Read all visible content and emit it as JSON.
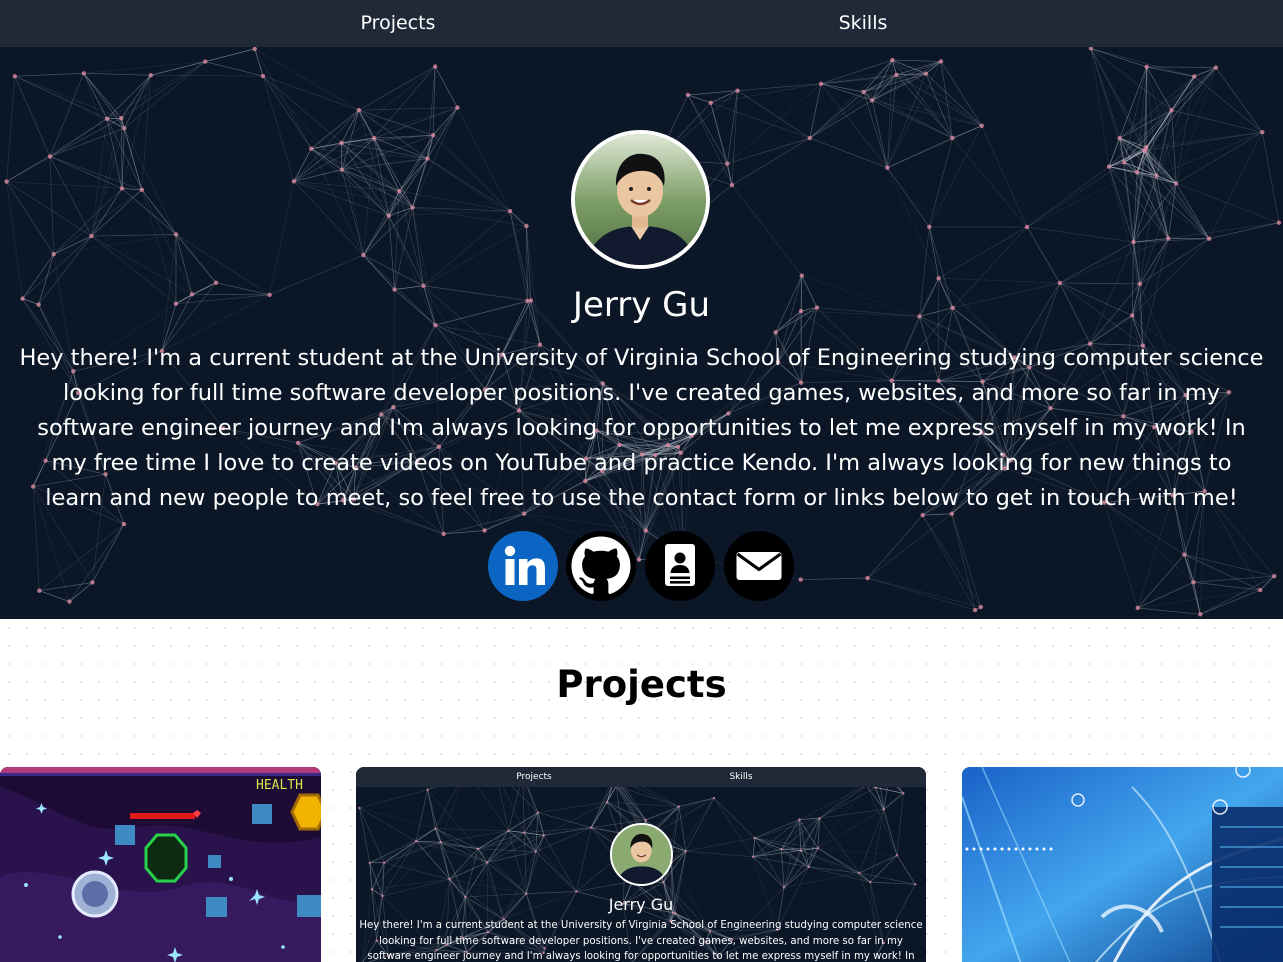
{
  "nav": {
    "items": [
      {
        "label": "Projects"
      },
      {
        "label": "Skills"
      }
    ]
  },
  "hero": {
    "name": "Jerry Gu",
    "bio_lines": [
      "Hey there! I'm a current student at the University of Virginia School of Engineering studying computer science",
      "looking for full time software developer positions. I've created games, websites, and more so far in my",
      "software engineer journey and I'm always looking for opportunities to let me express myself in my work! In",
      "my free time I love to create videos on YouTube and practice Kendo. I'm always looking for new things to",
      "learn and new people to meet, so feel free to use the contact form or links below to get in touch with me!"
    ],
    "socials": [
      {
        "icon": "linkedin-icon",
        "color": "#0a66c2"
      },
      {
        "icon": "github-icon",
        "color": "#000000"
      },
      {
        "icon": "resume-icon",
        "color": "#000000"
      },
      {
        "icon": "mail-icon",
        "color": "#000000"
      }
    ]
  },
  "projects": {
    "title": "Projects",
    "cards": [
      {
        "image": "pixel-space-game-screenshot",
        "hud_text": "HEALTH"
      },
      {
        "image": "portfolio-website-screenshot",
        "nav": [
          "Projects",
          "Skills"
        ],
        "name": "Jerry Gu",
        "bio_lines": [
          "Hey there! I'm a current student at the University of Virginia School of Engineering studying computer science",
          "looking for full time software developer positions. I've created games, websites, and more so far in my",
          "software engineer journey and I'm always looking for opportunities to let me express myself in my work! In"
        ]
      },
      {
        "image": "network-server-illustration"
      }
    ]
  },
  "colors": {
    "nav_bg": "#1f2937",
    "hero_bg": "#0b1626",
    "network_line": "#c7d0dc",
    "network_node": "#d98aa0",
    "linkedin": "#0a66c2"
  }
}
